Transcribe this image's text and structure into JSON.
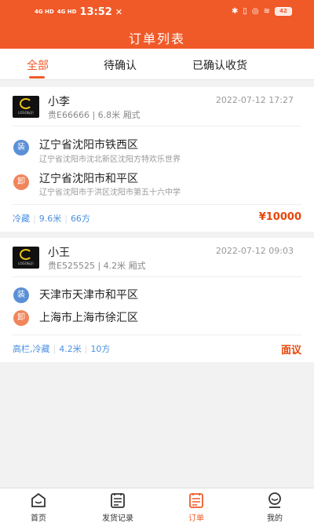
{
  "status_bar": {
    "signal_1": "4G HD",
    "signal_2": "4G HD",
    "time": "13:52",
    "battery": "42"
  },
  "header": {
    "title": "订单列表"
  },
  "tabs": [
    {
      "label": "全部",
      "active": true
    },
    {
      "label": "待确认",
      "active": false
    },
    {
      "label": "已确认收货",
      "active": false
    }
  ],
  "orders": [
    {
      "logo_text": "LOGO标识",
      "name": "小李",
      "plate_info": "贵E66666 | 6.8米 厢式",
      "date": "2022-07-12 17:27",
      "load_badge": "装",
      "load_address": "辽宁省沈阳市铁西区",
      "load_detail": "辽宁省沈阳市沈北新区沈阳方特欢乐世界",
      "unload_badge": "卸",
      "unload_address": "辽宁省沈阳市和平区",
      "unload_detail": "辽宁省沈阳市于洪区沈阳市第五十六中学",
      "tags": [
        "冷藏",
        "9.6米",
        "66方"
      ],
      "price": "¥10000"
    },
    {
      "logo_text": "LOGO标识",
      "name": "小王",
      "plate_info": "贵E525525 | 4.2米 厢式",
      "date": "2022-07-12 09:03",
      "load_badge": "装",
      "load_address": "天津市天津市和平区",
      "unload_badge": "卸",
      "unload_address": "上海市上海市徐汇区",
      "tags": [
        "高栏,冷藏",
        "4.2米",
        "10方"
      ],
      "price": "面议"
    }
  ],
  "bottom_nav": [
    {
      "label": "首页",
      "icon": "home-icon",
      "active": false
    },
    {
      "label": "发货记录",
      "icon": "shipping-record-icon",
      "active": false
    },
    {
      "label": "订单",
      "icon": "orders-icon",
      "active": true
    },
    {
      "label": "我的",
      "icon": "profile-icon",
      "active": false
    }
  ],
  "colors": {
    "brand": "#f05a28",
    "tag_blue": "#4a90e2",
    "price_red": "#e8450a",
    "load_blue": "#5b8fd6",
    "unload_orange": "#f0855c"
  }
}
